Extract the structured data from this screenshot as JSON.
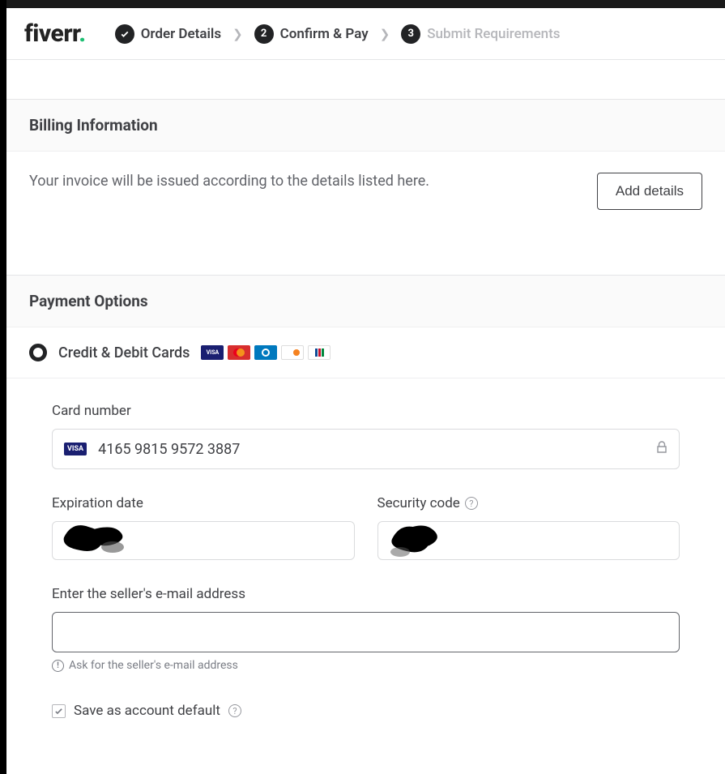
{
  "brand": {
    "name": "fiverr",
    "dot": "."
  },
  "steps": {
    "s1": {
      "label": "Order Details",
      "icon": "check"
    },
    "s2": {
      "num": "2",
      "label": "Confirm & Pay"
    },
    "s3": {
      "num": "3",
      "label": "Submit Requirements"
    }
  },
  "billing": {
    "heading": "Billing Information",
    "text": "Your invoice will be issued according to the details listed here.",
    "button": "Add details"
  },
  "payment": {
    "heading": "Payment Options",
    "method_label": "Credit & Debit Cards",
    "card_number_label": "Card number",
    "card_number_value": "4165 9815 9572 3887",
    "expiration_label": "Expiration date",
    "security_label": "Security code",
    "email_label": "Enter the seller's e-mail address",
    "email_hint": "Ask for the seller's e-mail address",
    "save_default_label": "Save as account default"
  },
  "icons": {
    "visa": "VISA"
  }
}
